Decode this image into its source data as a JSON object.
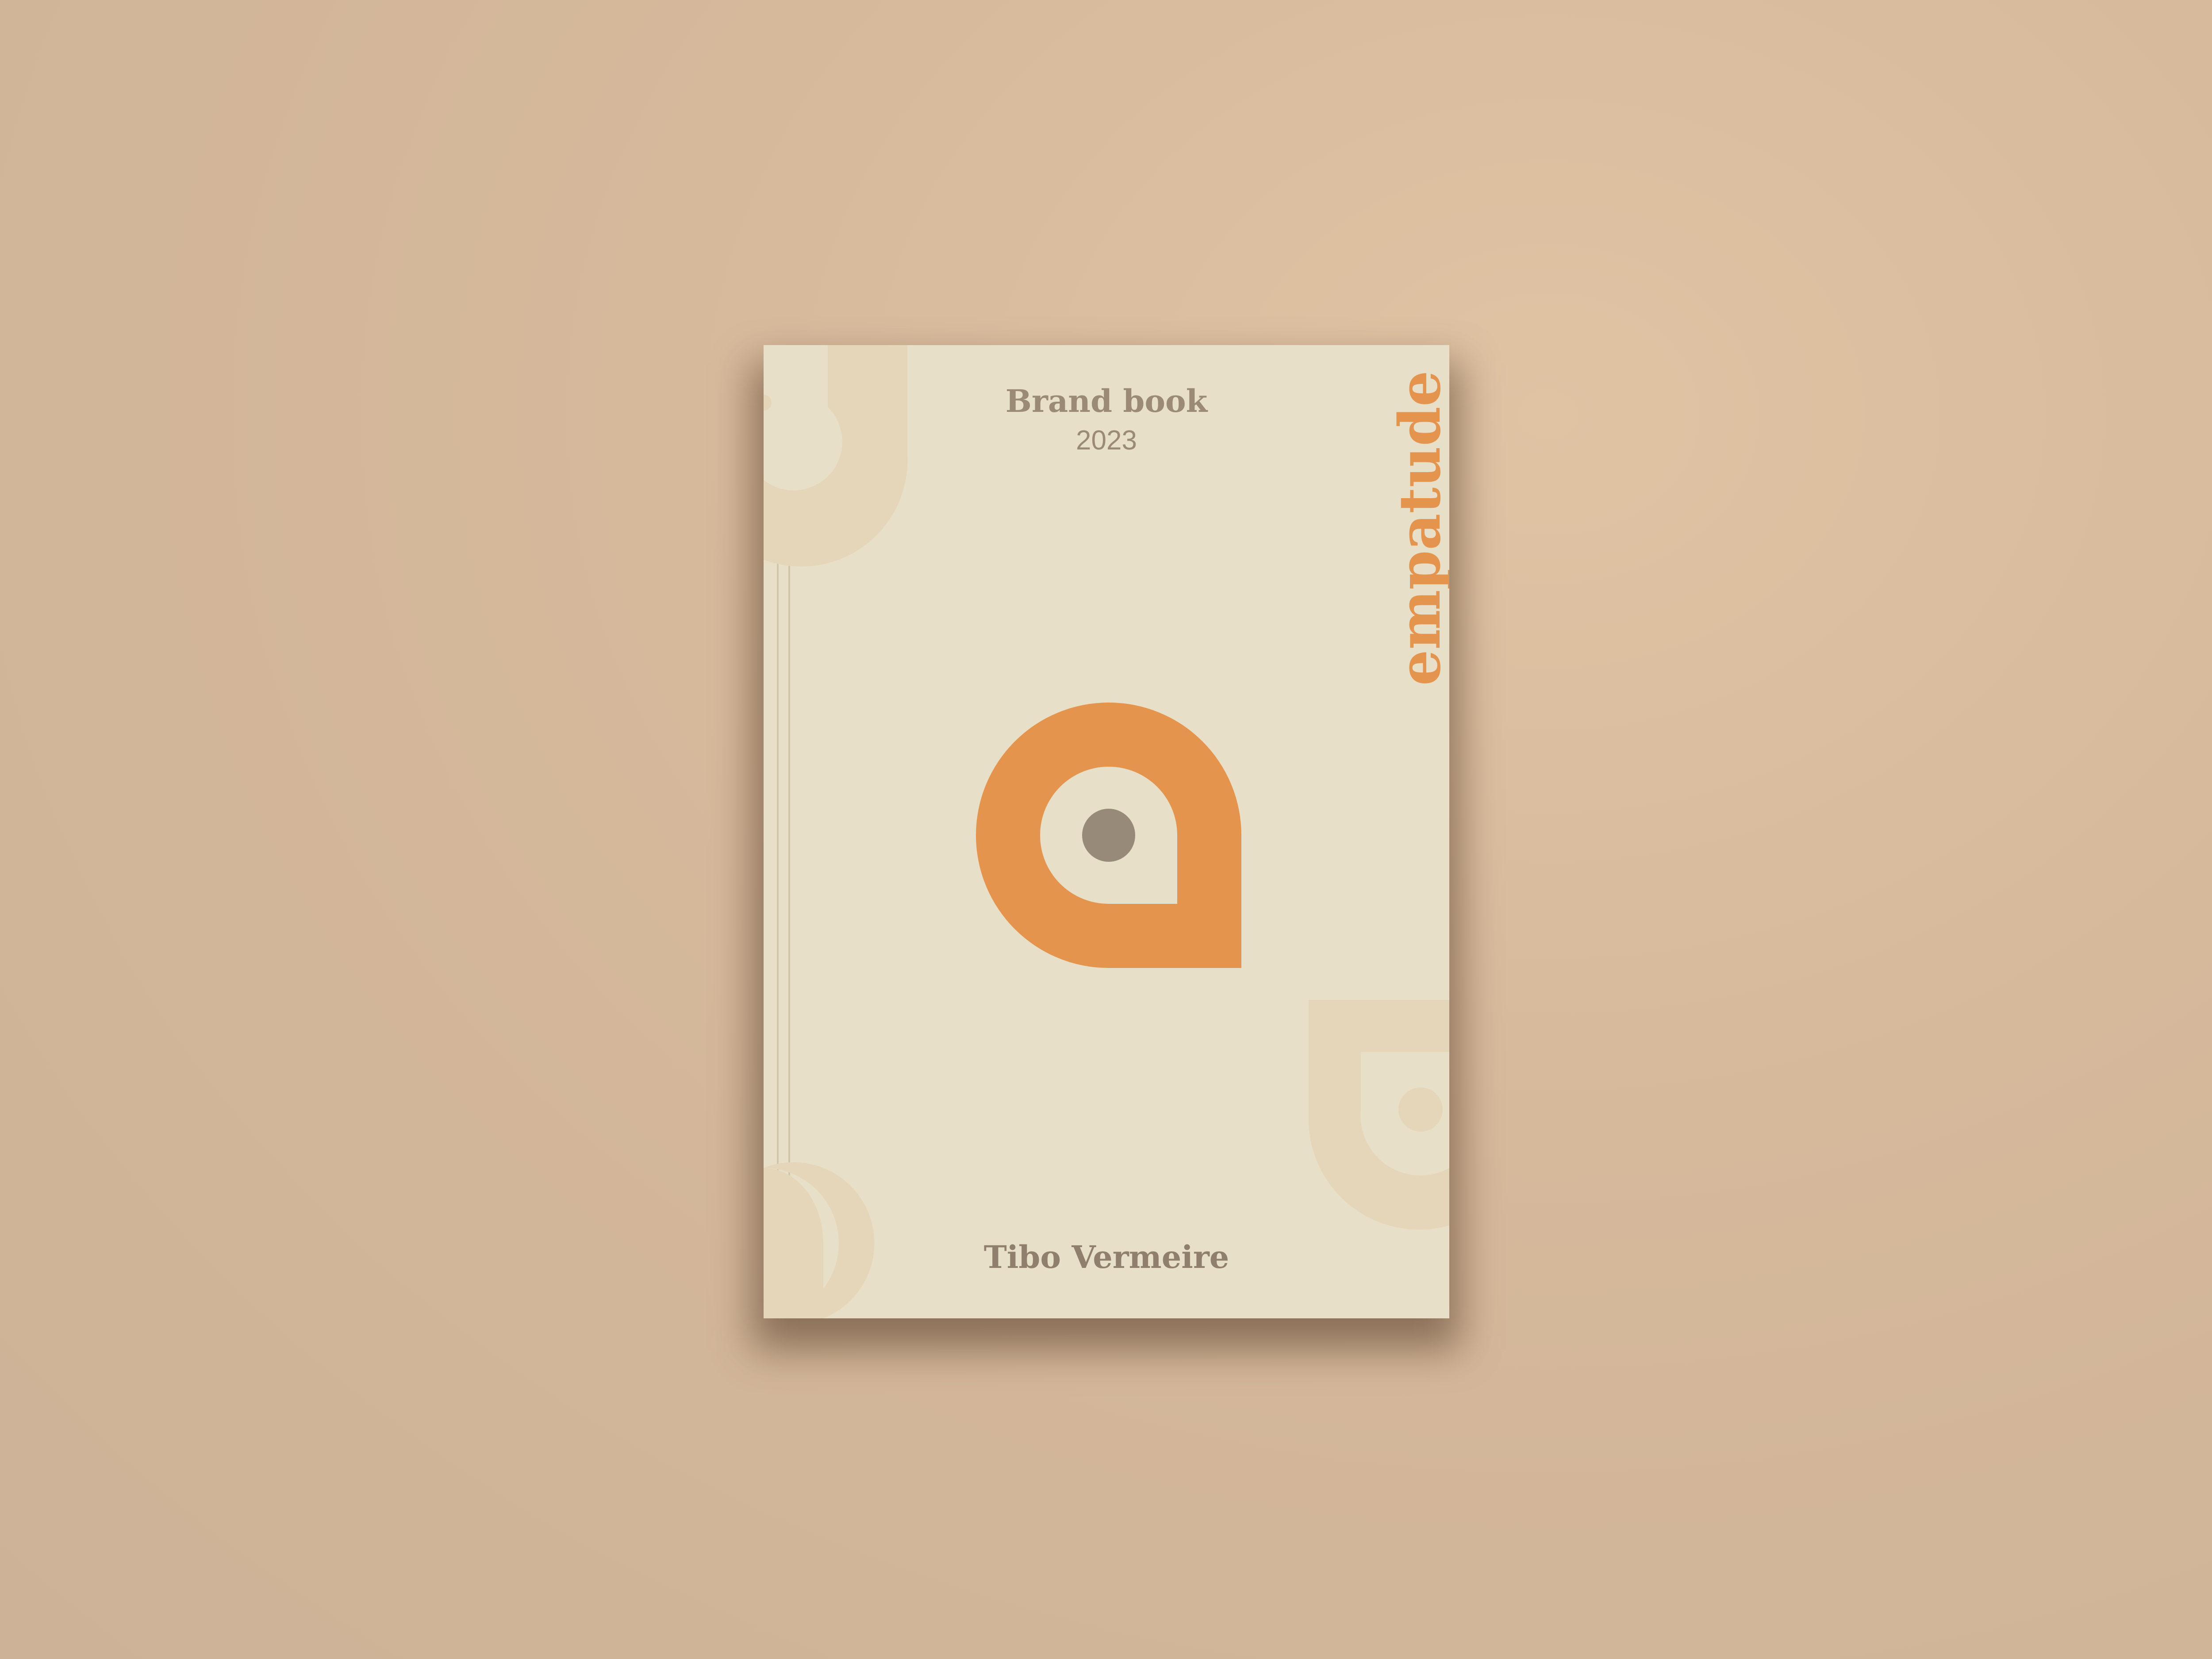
{
  "cover": {
    "title": "Brand book",
    "year": "2023",
    "author": "Tibo Vermeire",
    "wordmark": "empatude"
  },
  "colors": {
    "background": "#d6b99b",
    "cover": "#e7dfc7",
    "accent": "#e5944d",
    "text": "#9a8a76",
    "logo_dot": "#978a79",
    "decoration": "#e6d6b9"
  },
  "icons": {
    "logo": "teardrop-pin-logo-icon",
    "decorations": [
      "arc-decoration-top-left",
      "arc-decoration-bottom-right",
      "arc-decoration-bottom-left"
    ]
  }
}
